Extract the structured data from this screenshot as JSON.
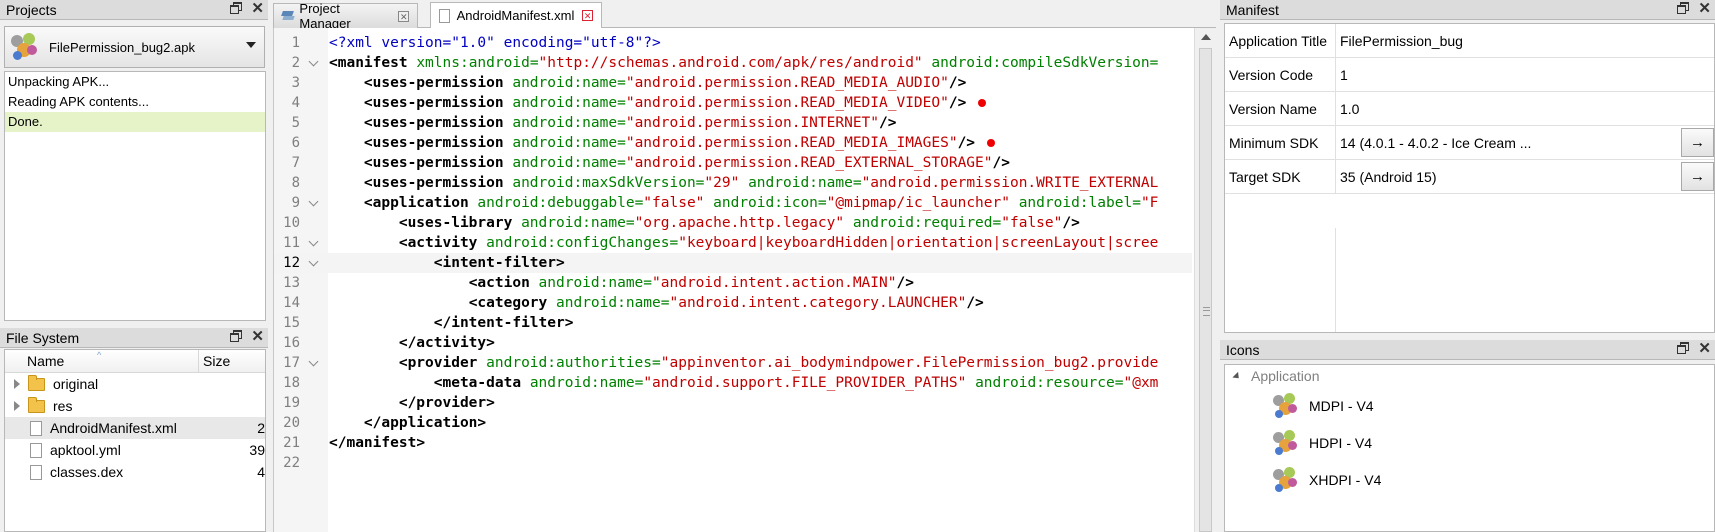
{
  "projects_panel": {
    "title": "Projects",
    "selected_project": "FilePermission_bug2.apk",
    "log": [
      "Unpacking APK...",
      "Reading APK contents...",
      "Done."
    ]
  },
  "filesystem_panel": {
    "title": "File System",
    "columns": {
      "name": "Name",
      "size": "Size"
    },
    "rows": [
      {
        "name": "original",
        "type": "folder",
        "size": ""
      },
      {
        "name": "res",
        "type": "folder",
        "size": ""
      },
      {
        "name": "AndroidManifest.xml",
        "type": "file",
        "size": "2"
      },
      {
        "name": "apktool.yml",
        "type": "file",
        "size": "39"
      },
      {
        "name": "classes.dex",
        "type": "file",
        "size": "4"
      }
    ]
  },
  "tabs": [
    {
      "label": "Project Manager",
      "icon": "layers-icon"
    },
    {
      "label": "AndroidManifest.xml",
      "icon": "file-icon"
    }
  ],
  "editor": {
    "current_line": 12,
    "breakpoint_lines": [
      4,
      6
    ],
    "fold_lines": [
      2,
      9,
      11,
      12,
      17
    ],
    "lines": [
      "<?xml version=\"1.0\" encoding=\"utf-8\"?>",
      "<manifest xmlns:android=\"http://schemas.android.com/apk/res/android\" android:compileSdkVersion=",
      "    <uses-permission android:name=\"android.permission.READ_MEDIA_AUDIO\"/>",
      "    <uses-permission android:name=\"android.permission.READ_MEDIA_VIDEO\"/>",
      "    <uses-permission android:name=\"android.permission.INTERNET\"/>",
      "    <uses-permission android:name=\"android.permission.READ_MEDIA_IMAGES\"/>",
      "    <uses-permission android:name=\"android.permission.READ_EXTERNAL_STORAGE\"/>",
      "    <uses-permission android:maxSdkVersion=\"29\" android:name=\"android.permission.WRITE_EXTERNAL",
      "    <application android:debuggable=\"false\" android:icon=\"@mipmap/ic_launcher\" android:label=\"F",
      "        <uses-library android:name=\"org.apache.http.legacy\" android:required=\"false\"/>",
      "        <activity android:configChanges=\"keyboard|keyboardHidden|orientation|screenLayout|scree",
      "            <intent-filter>",
      "                <action android:name=\"android.intent.action.MAIN\"/>",
      "                <category android:name=\"android.intent.category.LAUNCHER\"/>",
      "            </intent-filter>",
      "        </activity>",
      "        <provider android:authorities=\"appinventor.ai_bodymindpower.FilePermission_bug2.provide",
      "            <meta-data android:name=\"android.support.FILE_PROVIDER_PATHS\" android:resource=\"@xm",
      "        </provider>",
      "    </application>",
      "</manifest>",
      ""
    ]
  },
  "manifest_panel": {
    "title": "Manifest",
    "properties": [
      {
        "key": "Application Title",
        "value": "FilePermission_bug",
        "has_button": false
      },
      {
        "key": "Version Code",
        "value": "1",
        "has_button": false
      },
      {
        "key": "Version Name",
        "value": "1.0",
        "has_button": false
      },
      {
        "key": "Minimum SDK",
        "value": "14 (4.0.1 - 4.0.2 - Ice Cream ...",
        "has_button": true
      },
      {
        "key": "Target SDK",
        "value": "35 (Android 15)",
        "has_button": true
      }
    ],
    "arrow_symbol": "→"
  },
  "icons_panel": {
    "title": "Icons",
    "group": "Application",
    "items": [
      "MDPI - V4",
      "HDPI - V4",
      "XHDPI - V4"
    ]
  },
  "colors": {
    "tag": "#000000",
    "attribute": "#008000",
    "value": "#c00000",
    "processing_instruction": "#0000c0",
    "breakpoint": "#e00000",
    "selected_log": "#e6f3c8"
  }
}
